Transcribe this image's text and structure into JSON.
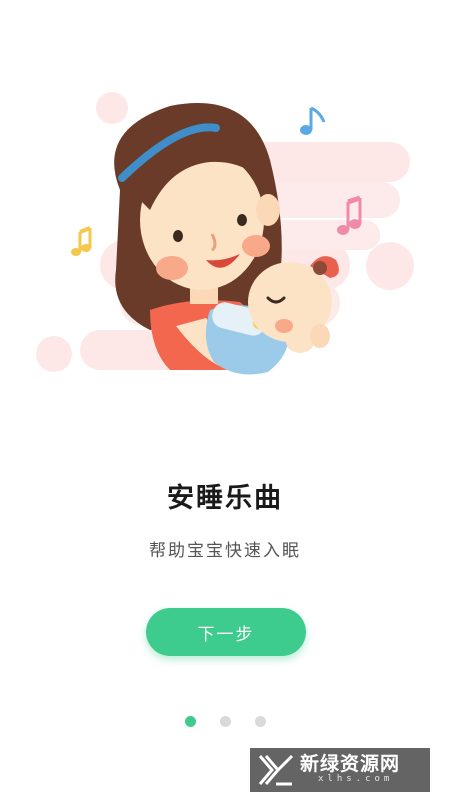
{
  "onboarding": {
    "title": "安睡乐曲",
    "subtitle": "帮助宝宝快速入眠",
    "next_button": "下一步",
    "page_index": 1,
    "page_count": 3
  },
  "illustration": {
    "subject": "mother-holding-baby-with-bottle",
    "decorations": [
      "music-note-icon",
      "music-note-icon",
      "music-note-icon"
    ]
  },
  "watermark": {
    "text_cn": "新绿资源网",
    "text_en": "xlhs.com"
  },
  "colors": {
    "accent": "#3dcc8e",
    "dot_inactive": "#d9d9d9",
    "title": "#1a1a1a",
    "subtitle": "#555555",
    "bg_blob": "#fde5e5"
  }
}
